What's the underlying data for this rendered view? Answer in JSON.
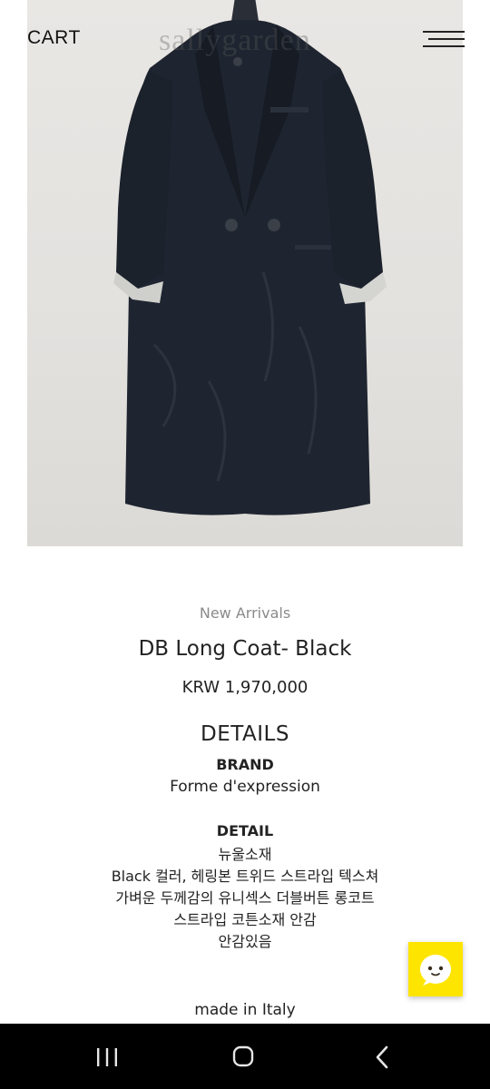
{
  "header": {
    "cart_label": "CART",
    "logo_text": "sallygarden"
  },
  "product": {
    "category": "New Arrivals",
    "title": "DB Long Coat- Black",
    "price": "KRW 1,970,000",
    "details_heading": "DETAILS",
    "brand_heading": "BRAND",
    "brand_value": "Forme d'expression",
    "detail_heading": "DETAIL",
    "detail_lines": [
      "뉴울소재",
      "Black 컬러, 헤링본 트위드 스트라입 텍스쳐",
      "가벼운 두께감의 유니섹스 더블버튼 롱코트",
      "스트라입 코튼소재 안감",
      "안감있음"
    ],
    "origin": "made in Italy"
  },
  "icons": {
    "menu": "hamburger-menu-icon",
    "chat": "kakao-chat-icon",
    "recent": "recent-apps-icon",
    "home": "home-icon",
    "back": "back-icon"
  },
  "colors": {
    "chat_button": "#FEE500",
    "nav_bar": "#000000"
  }
}
